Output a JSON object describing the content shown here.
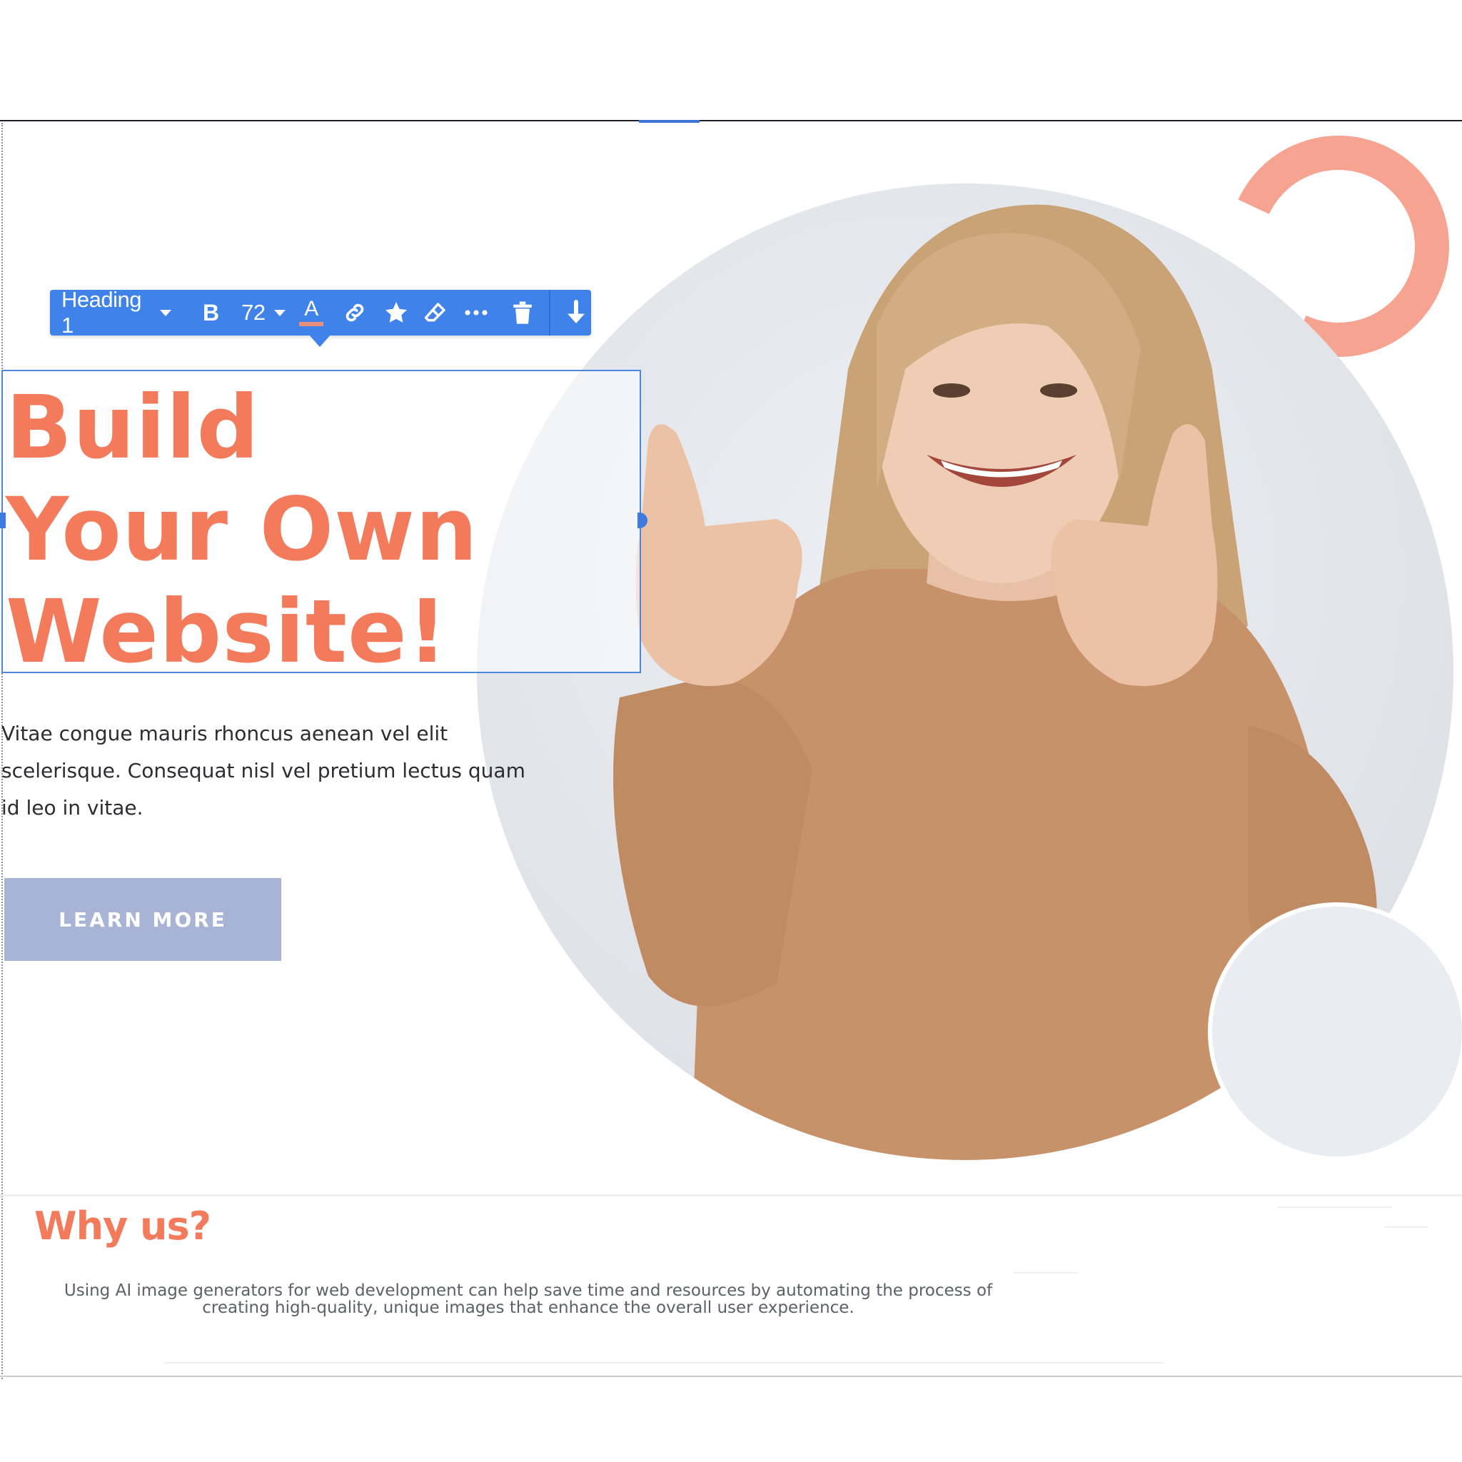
{
  "toolbar": {
    "style_label": "Heading 1",
    "bold_label": "B",
    "font_size": "72",
    "text_color_letter": "A",
    "icons": [
      "chevron-down-icon",
      "bold-icon",
      "chevron-down-icon",
      "text-color-icon",
      "link-icon",
      "star-icon",
      "eraser-icon",
      "more-icon",
      "trash-icon",
      "arrow-down-icon"
    ]
  },
  "hero": {
    "heading_lines": [
      "Build",
      "Your Own",
      "Website!"
    ],
    "paragraph": "Vitae congue mauris rhoncus aenean vel elit scelerisque. Consequat nisl vel pretium lectus quam id leo in vitae.",
    "button_label": "LEARN MORE"
  },
  "why": {
    "heading": "Why us?",
    "text": "Using AI image generators for web development can help save time and resources by automating the process of creating high-quality, unique images that enhance the overall user experience."
  },
  "colors": {
    "accent_coral": "#f47a5c",
    "toolbar_blue": "#3e82ea",
    "button_lavender": "#a7b4d6",
    "ring_salmon": "#f6a491",
    "text_color_swatch": "#e8907a"
  }
}
